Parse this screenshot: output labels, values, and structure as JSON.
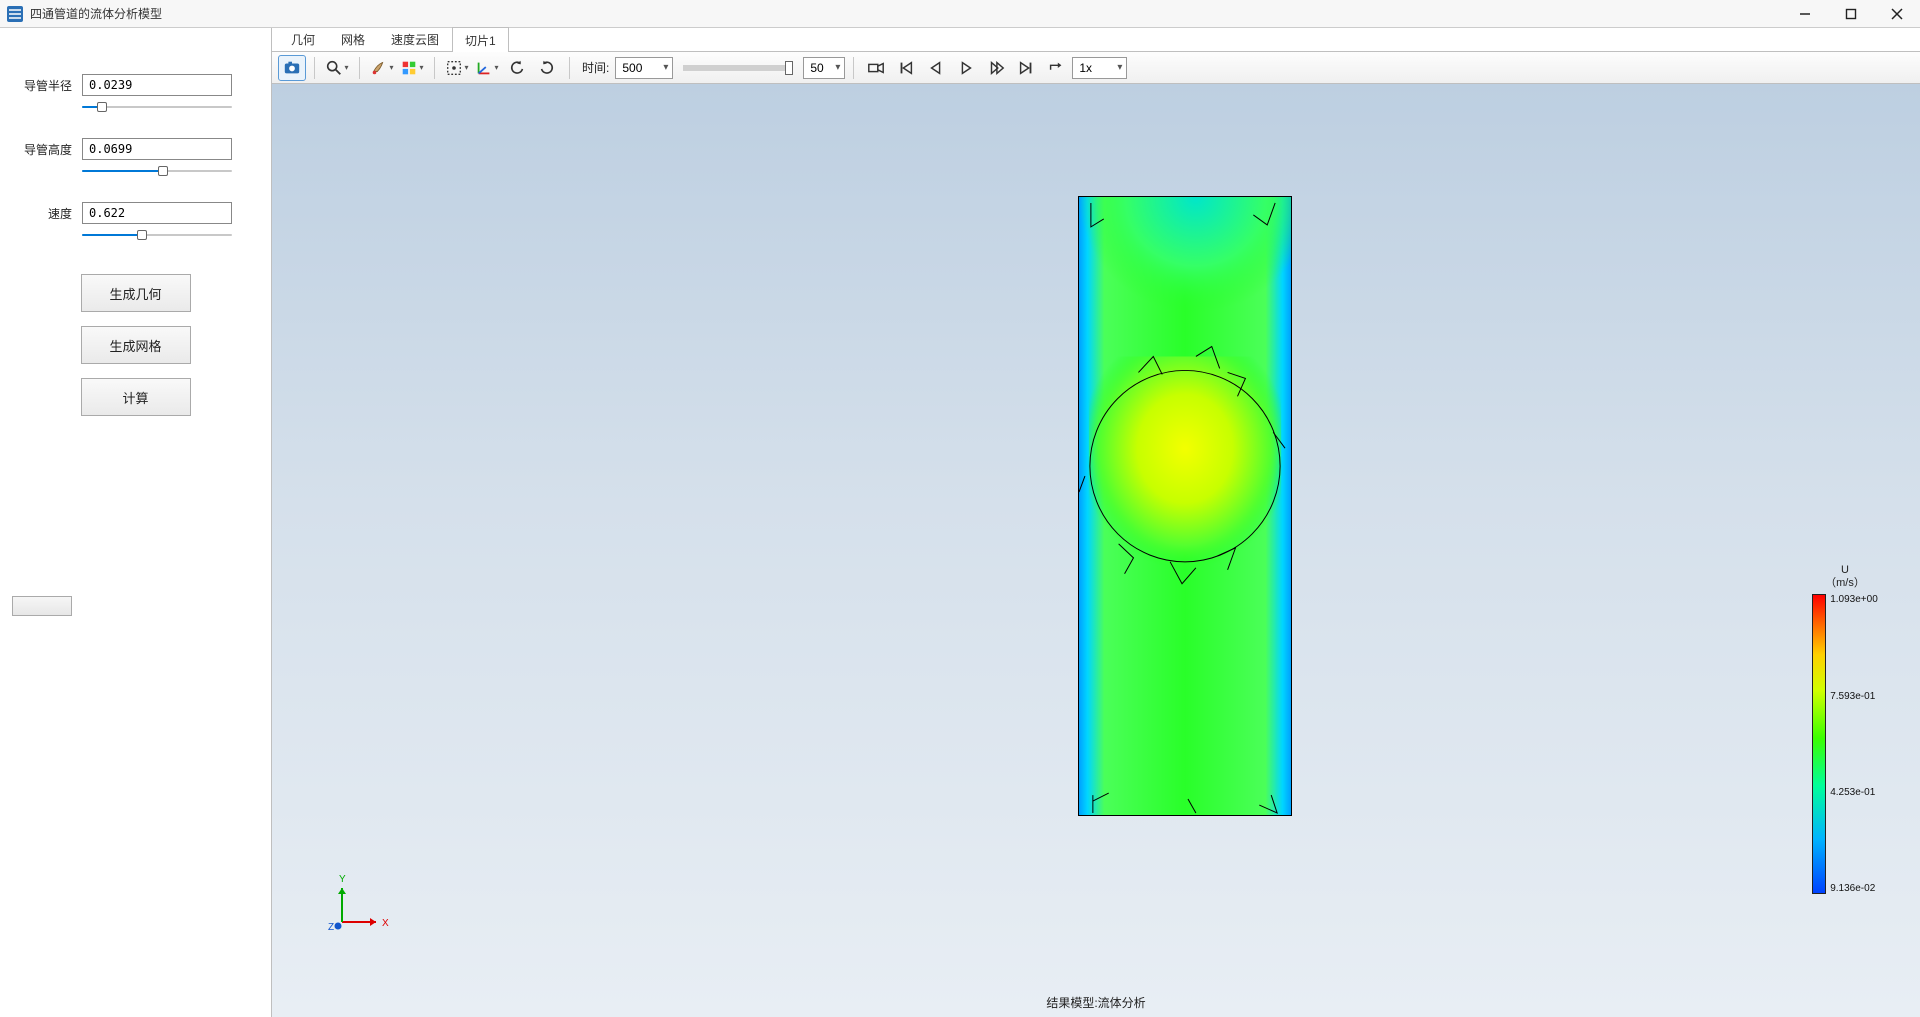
{
  "titlebar": {
    "title": "四通管道的流体分析模型"
  },
  "sidebar": {
    "params": [
      {
        "label": "导管半径",
        "value": "0.0239",
        "fill_pct": 13
      },
      {
        "label": "导管高度",
        "value": "0.0699",
        "fill_pct": 54
      },
      {
        "label": "速度",
        "value": "0.622",
        "fill_pct": 40
      }
    ],
    "buttons": {
      "gen_geom": "生成几何",
      "gen_mesh": "生成网格",
      "compute": "计算"
    }
  },
  "tabs": {
    "items": [
      "几何",
      "网格",
      "速度云图",
      "切片1"
    ],
    "active_index": 3
  },
  "toolbar": {
    "time_label": "时间:",
    "time_value": "500",
    "frame_value": "50",
    "speed_value": "1x"
  },
  "viewport": {
    "footer": "结果模型:流体分析",
    "axes": {
      "x": "X",
      "y": "Y",
      "z": "Z"
    }
  },
  "legend": {
    "var": "U",
    "unit": "（m/s）",
    "ticks": [
      "1.093e+00",
      "7.593e-01",
      "4.253e-01",
      "9.136e-02"
    ]
  }
}
